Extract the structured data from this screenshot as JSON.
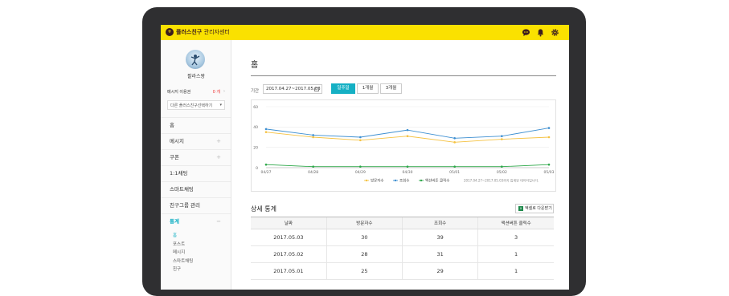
{
  "app": {
    "brand": "플러스친구",
    "title": "관리자센터"
  },
  "profile": {
    "name": "팔라스왕"
  },
  "message_quota": {
    "label": "메시지 이용권",
    "count": "0 개",
    "arrow": "›"
  },
  "account_select": {
    "value": "다른 플러스친구선택하기"
  },
  "menu": {
    "home": "홈",
    "message": "메시지",
    "coupon": "쿠폰",
    "chat": "1:1채팅",
    "smart_chat": "스마트채팅",
    "group": "친구그룹 관리",
    "stats": "통계",
    "plus": "+",
    "minus": "−"
  },
  "submenu": [
    "홈",
    "포스트",
    "메시지",
    "스마트채팅",
    "친구"
  ],
  "page": {
    "title": "홈"
  },
  "filter": {
    "label": "기간",
    "date_range": "2017.04.27~2017.05.03",
    "periods": [
      "일주일",
      "1개월",
      "3개월"
    ]
  },
  "chart_data": {
    "type": "line",
    "categories": [
      "04/27",
      "04/28",
      "04/29",
      "04/30",
      "05/01",
      "05/02",
      "05/03"
    ],
    "ylim": [
      0,
      60
    ],
    "yticks": [
      "0",
      "20",
      "40",
      "60"
    ],
    "grid": true,
    "series": [
      {
        "name": "방문자수",
        "color": "#f5c242",
        "values": [
          35,
          30,
          27,
          31,
          25,
          28,
          30
        ]
      },
      {
        "name": "조회수",
        "color": "#3d8fd1",
        "values": [
          38,
          32,
          30,
          37,
          29,
          31,
          39
        ]
      },
      {
        "name": "액션버튼 클릭수",
        "color": "#2ea84a",
        "values": [
          3,
          1,
          1,
          1,
          1,
          1,
          3
        ]
      }
    ],
    "note": "2017.04.27~2017.05.03까지 집계된 데이터입니다."
  },
  "detail": {
    "title": "상세 통계",
    "download": "엑셀로 다운받기",
    "columns": [
      "날짜",
      "방문자수",
      "조회수",
      "액션버튼 클릭수"
    ],
    "rows": [
      [
        "2017.05.03",
        "30",
        "39",
        "3"
      ],
      [
        "2017.05.02",
        "28",
        "31",
        "1"
      ],
      [
        "2017.05.01",
        "25",
        "29",
        "1"
      ]
    ]
  }
}
